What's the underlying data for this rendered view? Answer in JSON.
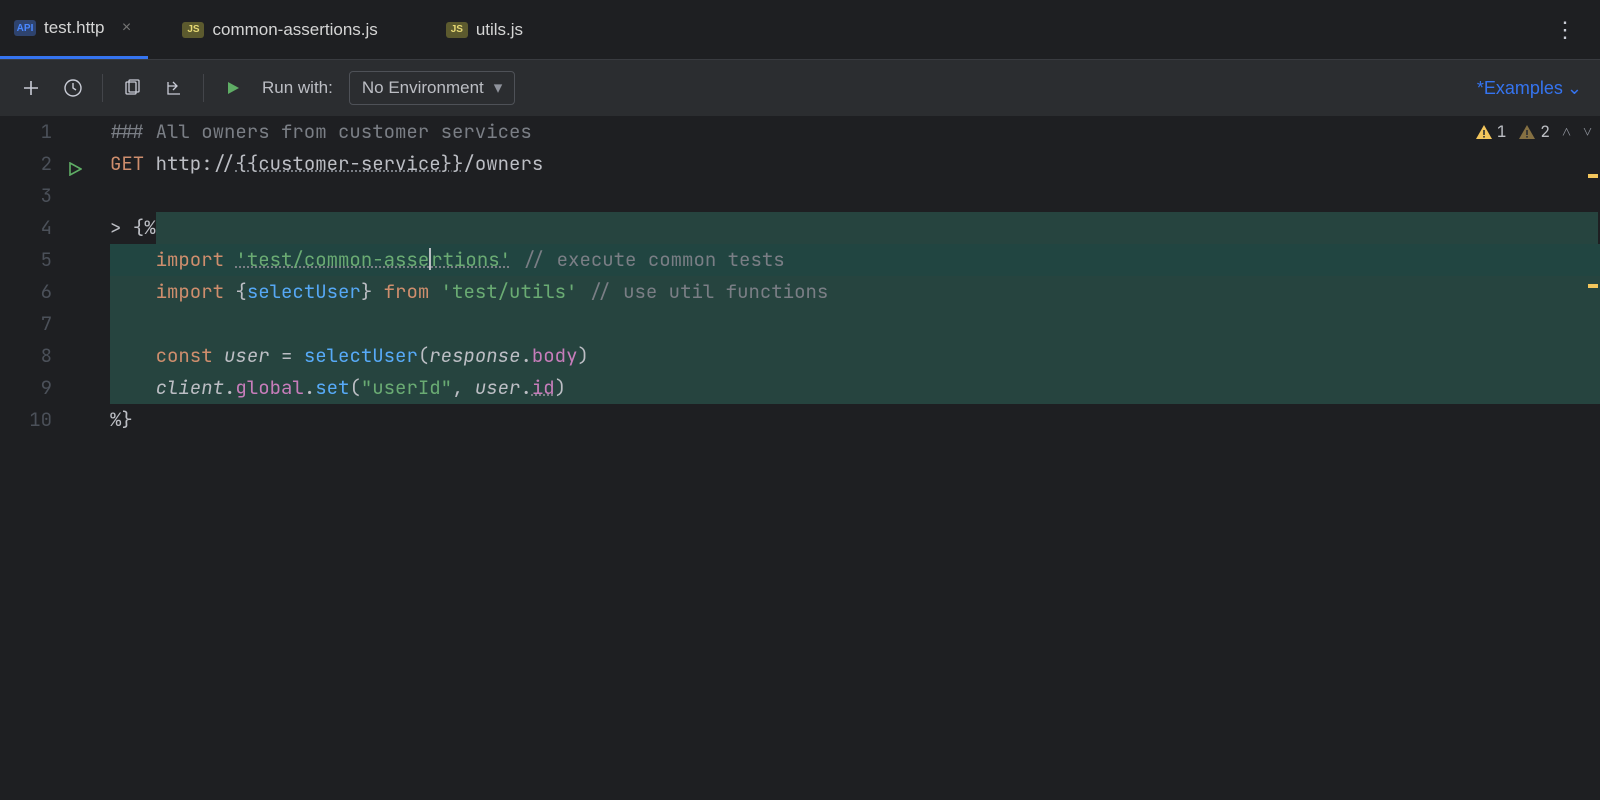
{
  "tabs": [
    {
      "icon": "API",
      "iconClass": "api-icon",
      "label": "test.http",
      "active": true,
      "closeable": true
    },
    {
      "icon": "JS",
      "iconClass": "js-icon",
      "label": "common-assertions.js",
      "active": false,
      "closeable": false
    },
    {
      "icon": "JS",
      "iconClass": "js-icon",
      "label": "utils.js",
      "active": false,
      "closeable": false
    }
  ],
  "toolbar": {
    "run_with_label": "Run with:",
    "environment": "No Environment",
    "examples_label": "*Examples"
  },
  "annotations": {
    "warn1_count": "1",
    "warn2_count": "2"
  },
  "code": {
    "l1_comment": "### All owners from customer services",
    "l2_method": "GET",
    "l2_url_pre": "http://",
    "l2_url_var": "{{customer-service}}",
    "l2_url_post": "/owners",
    "l4": "> {%",
    "l5_kw": "import",
    "l5_str": "'test/common-assertions'",
    "l5_comment": " // execute common tests",
    "l6_kw1": "import",
    "l6_brace_open": " {",
    "l6_ident": "selectUser",
    "l6_brace_close": "}",
    "l6_kw2": " from ",
    "l6_str": "'test/utils'",
    "l6_comment": " // use util functions",
    "l8_kw": "const",
    "l8_var": " user",
    "l8_eq": " = ",
    "l8_fn": "selectUser",
    "l8_paren_o": "(",
    "l8_param": "response",
    "l8_dot": ".",
    "l8_prop": "body",
    "l8_paren_c": ")",
    "l9_obj": "client",
    "l9_dot1": ".",
    "l9_p1": "global",
    "l9_dot2": ".",
    "l9_fn": "set",
    "l9_args_o": "(",
    "l9_str": "\"userId\"",
    "l9_comma": ", ",
    "l9_var": "user",
    "l9_dot3": ".",
    "l9_prop": "id",
    "l9_args_c": ")",
    "l10": "%}"
  },
  "line_numbers": [
    "1",
    "2",
    "3",
    "4",
    "5",
    "6",
    "7",
    "8",
    "9",
    "10"
  ]
}
